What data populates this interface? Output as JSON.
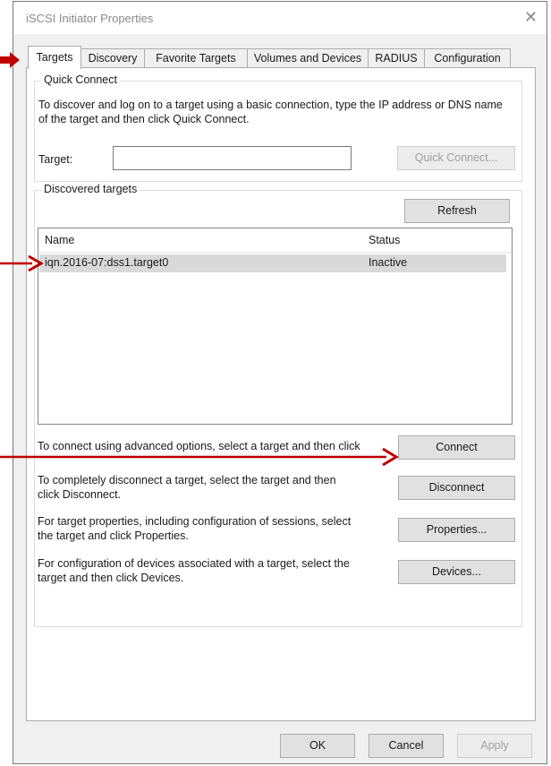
{
  "window": {
    "title": "iSCSI Initiator Properties",
    "close_glyph": "✕"
  },
  "tabs": [
    {
      "label": "Targets",
      "active": true
    },
    {
      "label": "Discovery"
    },
    {
      "label": "Favorite Targets"
    },
    {
      "label": "Volumes and Devices"
    },
    {
      "label": "RADIUS"
    },
    {
      "label": "Configuration"
    }
  ],
  "quick_connect": {
    "legend": "Quick Connect",
    "description": "To discover and log on to a target using a basic connection, type the IP address or DNS name of the target and then click Quick Connect.",
    "target_label": "Target:",
    "target_value": "",
    "button_label": "Quick Connect..."
  },
  "discovered": {
    "legend": "Discovered targets",
    "refresh_label": "Refresh",
    "columns": [
      "Name",
      "Status"
    ],
    "rows": [
      {
        "name": "iqn.2016-07:dss1.target0",
        "status": "Inactive"
      }
    ]
  },
  "actions": [
    {
      "text": "To connect using advanced options, select a target and then click Connect.",
      "button": "Connect"
    },
    {
      "text": "To completely disconnect a target, select the target and then click Disconnect.",
      "button": "Disconnect"
    },
    {
      "text": "For target properties, including configuration of sessions, select the target and click Properties.",
      "button": "Properties..."
    },
    {
      "text": "For configuration of devices associated with a target, select the target and then click Devices.",
      "button": "Devices..."
    }
  ],
  "footer": {
    "ok": "OK",
    "cancel": "Cancel",
    "apply": "Apply"
  },
  "annotation_color": "#c00000"
}
